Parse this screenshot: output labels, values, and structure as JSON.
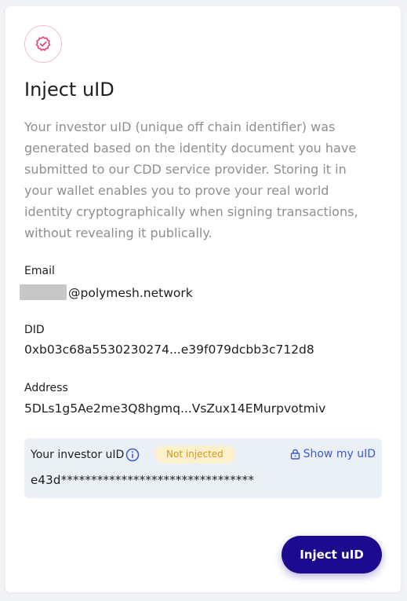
{
  "header": {
    "icon": "verified-badge-icon",
    "title": "Inject uID"
  },
  "description": "Your investor uID (unique off chain identifier) was generated based on the identity document you have submitted to our CDD service provider. Storing it in your wallet enables you to prove your real world identity cryptographically when signing transactions, without revealing it publically.",
  "fields": {
    "email_label": "Email",
    "email_value": "@polymesh.network",
    "did_label": "DID",
    "did_value": "0xb03c68a5530230274...e39f079dcbb3c712d8",
    "address_label": "Address",
    "address_value": "5DLs1g5Ae2me3Q8hgmq...VsZux14EMurpvotmiv"
  },
  "uid": {
    "label": "Your investor uID",
    "info_icon": "info-icon",
    "status": "Not injected",
    "show_label": "Show my uID",
    "show_icon": "lock-icon",
    "value": "e43d********************************"
  },
  "actions": {
    "inject_label": "Inject uID"
  },
  "colors": {
    "accent": "#1c0a8f",
    "badge_border": "#f3bfd2",
    "badge_icon": "#e0457b",
    "status_bg": "#fdf0cc",
    "status_text": "#d39a1c",
    "link": "#3c59d9",
    "uid_box_bg": "#ebeff6"
  }
}
